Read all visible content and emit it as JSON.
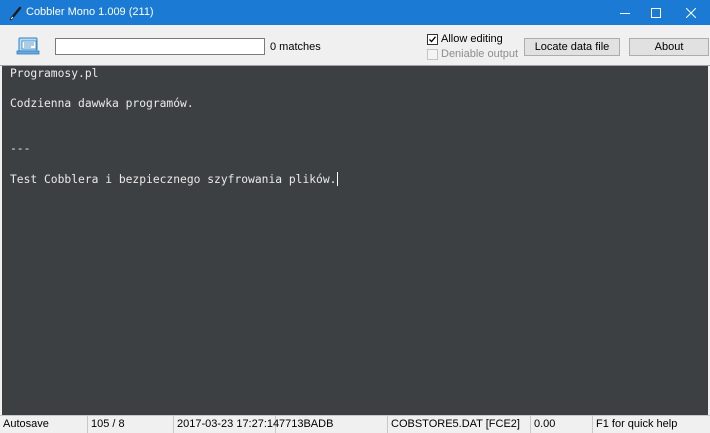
{
  "window": {
    "title": "Cobbler Mono 1.009 (211)",
    "minimize_icon": "minimize-icon",
    "maximize_icon": "maximize-icon",
    "close_icon": "close-icon",
    "titlebar_color": "#1a7ad4"
  },
  "toolbar": {
    "app_icon": "document-icon",
    "search": {
      "value": "",
      "placeholder": ""
    },
    "matches_label": "0 matches",
    "allow_editing": {
      "label": "Allow editing",
      "checked": true,
      "enabled": true
    },
    "deniable_output": {
      "label": "Deniable output",
      "checked": false,
      "enabled": false
    },
    "locate_button": "Locate data file",
    "about_button": "About"
  },
  "editor": {
    "background": "#3d4043",
    "text_color": "#eaeaea",
    "lines": [
      "Programosy.pl",
      "",
      "Codzienna dawwka programów.",
      "",
      "",
      "---",
      "",
      "Test Cobblera i bezpiecznego szyfrowania plików."
    ]
  },
  "statusbar": {
    "autosave": "Autosave",
    "position": "105 / 8",
    "timestamp": "2017-03-23 17:27:14",
    "hash": "7713BADB",
    "datafile": "COBSTORE5.DAT [FCE2]",
    "value": "0.00",
    "help": "F1 for quick help"
  }
}
